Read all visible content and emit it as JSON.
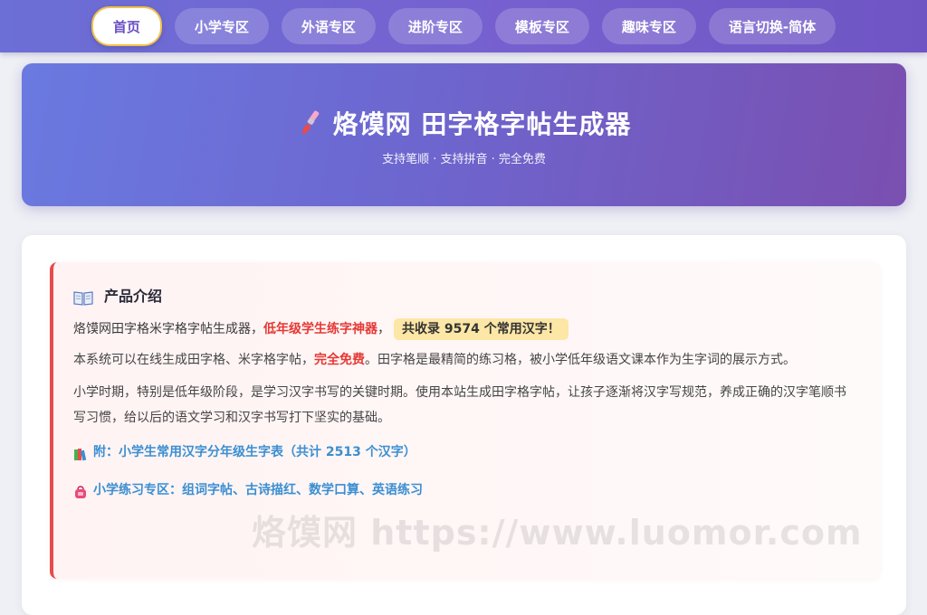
{
  "nav": {
    "items": [
      {
        "label": "首页",
        "active": true
      },
      {
        "label": "小学专区",
        "active": false
      },
      {
        "label": "外语专区",
        "active": false
      },
      {
        "label": "进阶专区",
        "active": false
      },
      {
        "label": "模板专区",
        "active": false
      },
      {
        "label": "趣味专区",
        "active": false
      },
      {
        "label": "语言切换-简体",
        "active": false
      }
    ]
  },
  "hero": {
    "icon": "paintbrush-icon",
    "title": "烙馍网 田字格字帖生成器",
    "subtitle": "支持笔顺 · 支持拼音 · 完全免费"
  },
  "intro": {
    "icon": "open-book-icon",
    "heading": "产品介绍",
    "line1_prefix": "烙馍网田字格米字格字帖生成器，",
    "line1_highlight": "低年级学生练字神器",
    "line1_sep": "，",
    "line1_badge": "共收录 9574 个常用汉字！",
    "para2_prefix": "本系统可以在线生成田字格、米字格字帖，",
    "para2_highlight": "完全免费",
    "para2_suffix": "。田字格是最精简的练习格，被小学低年级语文课本作为生字词的展示方式。",
    "para3": "小学时期，特别是低年级阶段，是学习汉字书写的关键时期。使用本站生成田字格字帖，让孩子逐渐将汉字写规范，养成正确的汉字笔顺书写习惯，给以后的语文学习和汉字书写打下坚实的基础。",
    "link1": {
      "icon": "books-icon",
      "label": "附：小学生常用汉字分年级生字表（共计 2513 个汉字）"
    },
    "link2": {
      "icon": "school-bag-icon",
      "label": "小学练习专区：组词字帖、古诗描红、数学口算、英语练习"
    }
  },
  "watermark": "烙馍网 https://www.luomor.com",
  "colors": {
    "nav_bg": "#7262d1",
    "accent_red": "#e53935",
    "link_blue": "#3a8fd1",
    "badge_bg": "#fde7a6"
  }
}
